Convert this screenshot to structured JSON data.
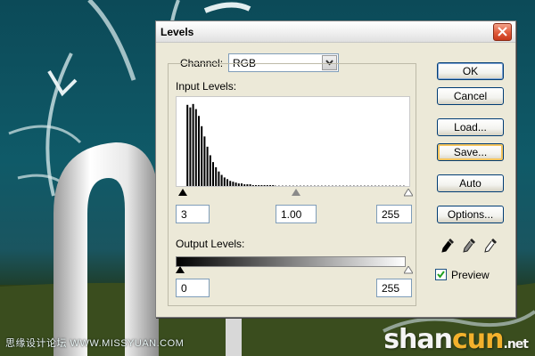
{
  "dialog": {
    "title": "Levels",
    "channel_label": "Channel:",
    "channel_value": "RGB",
    "input_levels_label": "Input Levels:",
    "input_black": "3",
    "input_gamma": "1.00",
    "input_white": "255",
    "output_levels_label": "Output Levels:",
    "output_black": "0",
    "output_white": "255",
    "buttons": {
      "ok": "OK",
      "cancel": "Cancel",
      "load": "Load...",
      "save": "Save...",
      "auto": "Auto",
      "options": "Options..."
    },
    "preview_label": "Preview",
    "preview_checked": true
  },
  "histogram": [
    0,
    95,
    92,
    96,
    90,
    82,
    70,
    58,
    46,
    36,
    28,
    22,
    17,
    13,
    10,
    8,
    6,
    5,
    4,
    3,
    3,
    2,
    2,
    2,
    1,
    1,
    1,
    1,
    1,
    1,
    1,
    1
  ],
  "watermarks": {
    "left": "思缘设计论坛 WWW.MISSYUAN.COM",
    "right_main": "shan",
    "right_accent": "cun",
    "right_suffix": ".net"
  },
  "colors": {
    "dialog_bg": "#ece9d8",
    "button_border": "#003c74",
    "focus_ring": "#f5c55e",
    "close_button": "#e05a3a"
  }
}
